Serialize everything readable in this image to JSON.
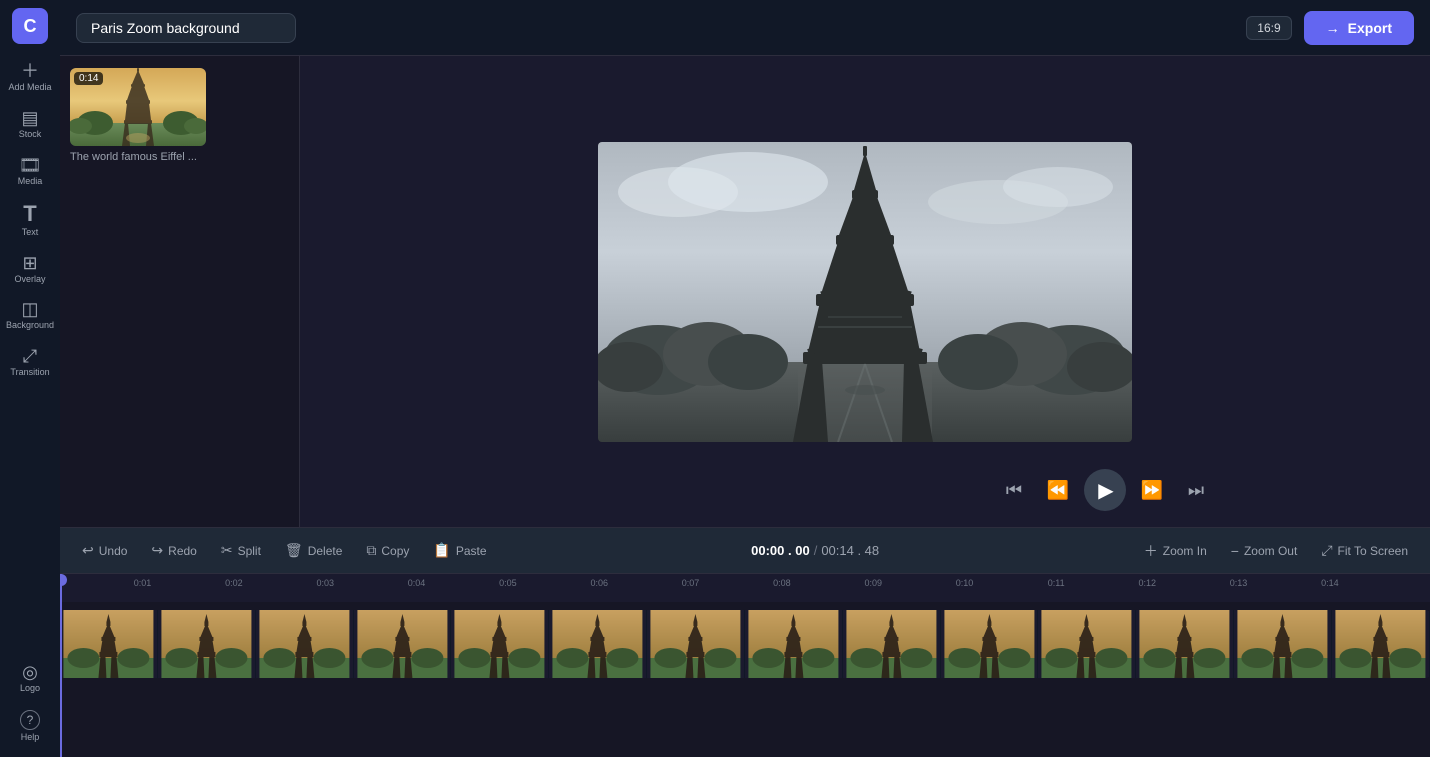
{
  "app": {
    "logo": "C",
    "title": "Paris Zoom background"
  },
  "header": {
    "project_name": "Paris Zoom background",
    "aspect_ratio": "16:9",
    "export_label": "Export",
    "export_icon": "→"
  },
  "sidebar": {
    "items": [
      {
        "id": "add-media",
        "icon": "+",
        "label": "Add Media"
      },
      {
        "id": "stock",
        "icon": "▤",
        "label": "Stock"
      },
      {
        "id": "media",
        "icon": "🎞",
        "label": "Media"
      },
      {
        "id": "text",
        "icon": "T",
        "label": "Text"
      },
      {
        "id": "overlay",
        "icon": "⊞",
        "label": "Overlay"
      },
      {
        "id": "background",
        "icon": "◫",
        "label": "Background"
      },
      {
        "id": "transition",
        "icon": "⤢",
        "label": "Transition"
      },
      {
        "id": "logo",
        "icon": "◎",
        "label": "Logo"
      },
      {
        "id": "help",
        "icon": "?",
        "label": "Help"
      }
    ]
  },
  "media_panel": {
    "item": {
      "duration": "0:14",
      "title": "The world famous Eiffel ..."
    }
  },
  "preview": {
    "aspect_badge": "16:9"
  },
  "playback": {
    "skip_back_icon": "⏮",
    "rewind_icon": "⏪",
    "play_icon": "▶",
    "fast_forward_icon": "⏩",
    "skip_forward_icon": "⏭"
  },
  "timeline_toolbar": {
    "undo_label": "Undo",
    "redo_label": "Redo",
    "split_label": "Split",
    "delete_label": "Delete",
    "copy_label": "Copy",
    "paste_label": "Paste",
    "zoom_in_label": "Zoom In",
    "zoom_out_label": "Zoom Out",
    "fit_to_screen_label": "Fit To Screen",
    "time_current": "00:00 . 00",
    "time_separator": "/",
    "time_total": "00:14 . 48"
  },
  "timeline": {
    "ruler_marks": [
      "0:01",
      "0:02",
      "0:03",
      "0:04",
      "0:05",
      "0:06",
      "0:07",
      "0:08",
      "0:09",
      "0:10",
      "0:11",
      "0:12",
      "0:13",
      "0:14"
    ],
    "playhead_position_percent": 0
  }
}
